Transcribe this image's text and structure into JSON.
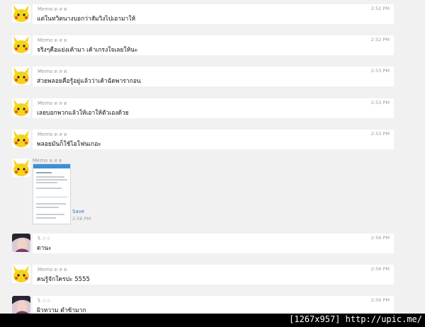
{
  "messages": [
    {
      "sender": "Memo ต ส ต",
      "text": "แต่ในทวิตนางบอกว่าสัมวิงไปเอามาให้",
      "time": "2:52 PM"
    },
    {
      "sender": "Memo ต ส ต",
      "text": "จริงๆคือแย่งเค้ามา เค้าเกรงใจเลยให้นะ",
      "time": "2:52 PM"
    },
    {
      "sender": "Memo ต ส ต",
      "text": "ส่วยพลอยคือรู้อยู่แล้วว่าเค้าฉัดพารากอน",
      "time": "2:53 PM"
    },
    {
      "sender": "Memo ต ส ต",
      "text": "เลยบอกพวกแล้วให้เอาให้ตัวเองด้วย",
      "time": "2:53 PM"
    },
    {
      "sender": "Memo ต ส ต",
      "text": "พลอยมันก็ใช้ไอโฟนเกอะ",
      "time": "2:53 PM"
    }
  ],
  "image_message": {
    "sender": "Memo ต ส ต",
    "save_label": "Save",
    "time": "2:56 PM"
  },
  "messages2": [
    {
      "sender": "ริ.☆☆",
      "text": "ดานะ",
      "time": "2:56 PM"
    },
    {
      "sender": "Memo ต ส ต",
      "text": "คนรู้จักใครปะ 5555",
      "time": "2:56 PM"
    },
    {
      "sender": "ริ.☆☆",
      "text": "ผิวหวาม ดำซ้ามาก",
      "time": "2:56 PM"
    }
  ],
  "footer": {
    "text": "[1267x957] http://upic.me/"
  }
}
